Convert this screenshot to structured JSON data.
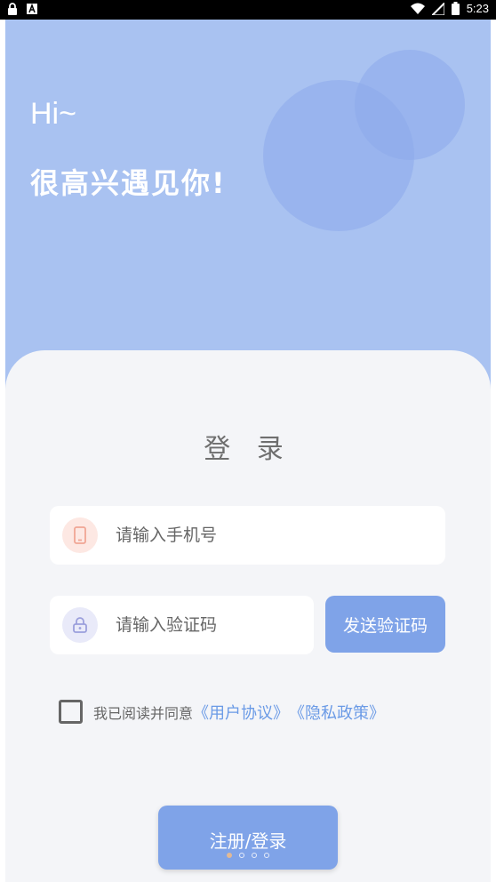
{
  "status_bar": {
    "time": "5:23",
    "left_icons": [
      "lock-icon",
      "font-a-icon"
    ],
    "right_icons": [
      "wifi-icon",
      "signal-icon",
      "battery-icon"
    ]
  },
  "hero": {
    "greeting": "Hi~",
    "subtitle": "很高兴遇见你!",
    "background_color": "#a9c2f1"
  },
  "login": {
    "title": "登 录",
    "phone": {
      "placeholder": "请输入手机号",
      "value": "",
      "icon": "phone-icon"
    },
    "code": {
      "placeholder": "请输入验证码",
      "value": "",
      "icon": "lock-icon"
    },
    "send_code_label": "发送验证码",
    "agreement": {
      "checked": false,
      "prefix": "我已阅读并同意",
      "user_agreement": "《用户协议》",
      "privacy_policy": "《隐私政策》"
    },
    "submit_label": "注册/登录",
    "accent_color": "#7fa3e8"
  }
}
